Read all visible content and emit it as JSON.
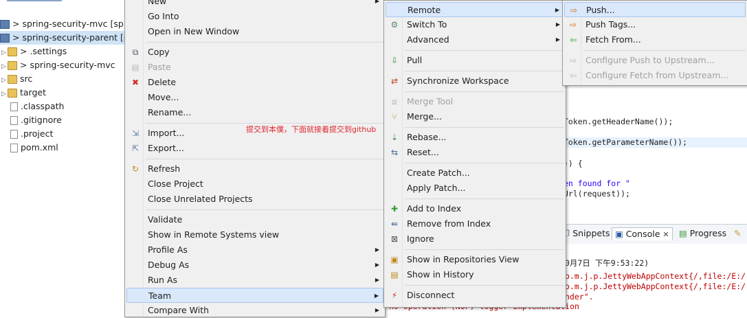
{
  "explorer": {
    "items": [
      {
        "label": "> spring-security-mvc  [sprin",
        "kind": "project"
      },
      {
        "label": "> spring-security-parent  [sp",
        "kind": "project"
      },
      {
        "label": "> .settings",
        "kind": "folder"
      },
      {
        "label": "> spring-security-mvc",
        "kind": "folder"
      },
      {
        "label": "src",
        "kind": "folder"
      },
      {
        "label": "target",
        "kind": "folder"
      },
      {
        "label": ".classpath",
        "kind": "file"
      },
      {
        "label": ".gitignore",
        "kind": "file"
      },
      {
        "label": ".project",
        "kind": "file"
      },
      {
        "label": "pom.xml",
        "kind": "file"
      }
    ]
  },
  "annotation": "提交到本僕，下面就接着提交到github",
  "main_menu": {
    "items": [
      {
        "label": "New",
        "icon": "none",
        "submenu": true,
        "disabled": false
      },
      {
        "label": "Go Into",
        "icon": "none",
        "submenu": false,
        "disabled": false
      },
      {
        "label": "Open in New Window",
        "icon": "none",
        "submenu": false,
        "disabled": false
      },
      {
        "label": "Copy",
        "icon": "copy-icon",
        "submenu": false,
        "disabled": false
      },
      {
        "label": "Paste",
        "icon": "paste-icon",
        "submenu": false,
        "disabled": true
      },
      {
        "label": "Delete",
        "icon": "delete-icon",
        "submenu": false,
        "disabled": false
      },
      {
        "label": "Move...",
        "icon": "none",
        "submenu": false,
        "disabled": false
      },
      {
        "label": "Rename...",
        "icon": "none",
        "submenu": false,
        "disabled": false
      },
      {
        "label": "Import...",
        "icon": "import-icon",
        "submenu": false,
        "disabled": false
      },
      {
        "label": "Export...",
        "icon": "export-icon",
        "submenu": false,
        "disabled": false
      },
      {
        "label": "Refresh",
        "icon": "refresh-icon",
        "submenu": false,
        "disabled": false
      },
      {
        "label": "Close Project",
        "icon": "none",
        "submenu": false,
        "disabled": false
      },
      {
        "label": "Close Unrelated Projects",
        "icon": "none",
        "submenu": false,
        "disabled": false
      },
      {
        "label": "Validate",
        "icon": "none",
        "submenu": false,
        "disabled": false
      },
      {
        "label": "Show in Remote Systems view",
        "icon": "none",
        "submenu": false,
        "disabled": false
      },
      {
        "label": "Profile As",
        "icon": "none",
        "submenu": true,
        "disabled": false
      },
      {
        "label": "Debug As",
        "icon": "none",
        "submenu": true,
        "disabled": false
      },
      {
        "label": "Run As",
        "icon": "none",
        "submenu": true,
        "disabled": false
      },
      {
        "label": "Team",
        "icon": "none",
        "submenu": true,
        "disabled": false,
        "highlighted": true
      },
      {
        "label": "Compare With",
        "icon": "none",
        "submenu": true,
        "disabled": false
      }
    ]
  },
  "team_menu": {
    "items": [
      {
        "label": "Remote",
        "icon": "none",
        "submenu": true,
        "highlighted": true
      },
      {
        "label": "Switch To",
        "icon": "switch-icon",
        "submenu": true
      },
      {
        "label": "Advanced",
        "icon": "none",
        "submenu": true
      },
      {
        "label": "Pull",
        "icon": "pull-icon",
        "submenu": false
      },
      {
        "label": "Synchronize Workspace",
        "icon": "synchronize-icon",
        "submenu": false
      },
      {
        "label": "Merge Tool",
        "icon": "merge-tool-icon",
        "submenu": false,
        "disabled": true
      },
      {
        "label": "Merge...",
        "icon": "merge-icon",
        "submenu": false
      },
      {
        "label": "Rebase...",
        "icon": "rebase-icon",
        "submenu": false
      },
      {
        "label": "Reset...",
        "icon": "reset-icon",
        "submenu": false
      },
      {
        "label": "Create Patch...",
        "icon": "none",
        "submenu": false
      },
      {
        "label": "Apply Patch...",
        "icon": "none",
        "submenu": false
      },
      {
        "label": "Add to Index",
        "icon": "add-icon",
        "submenu": false
      },
      {
        "label": "Remove from Index",
        "icon": "remove-index-icon",
        "submenu": false
      },
      {
        "label": "Ignore",
        "icon": "ignore-icon",
        "submenu": false
      },
      {
        "label": "Show in Repositories View",
        "icon": "repositories-icon",
        "submenu": false
      },
      {
        "label": "Show in History",
        "icon": "history-icon",
        "submenu": false
      },
      {
        "label": "Disconnect",
        "icon": "disconnect-icon",
        "submenu": false
      }
    ]
  },
  "remote_menu": {
    "items": [
      {
        "label": "Push...",
        "icon": "push-icon",
        "highlighted": true
      },
      {
        "label": "Push Tags...",
        "icon": "push-tags-icon"
      },
      {
        "label": "Fetch From...",
        "icon": "fetch-icon"
      },
      {
        "label": "Configure Push to Upstream...",
        "icon": "configure-push-icon",
        "disabled": true
      },
      {
        "label": "Configure Fetch from Upstream...",
        "icon": "configure-fetch-icon",
        "disabled": true
      }
    ]
  },
  "editor": {
    "lines": [
      "Token.getHeaderName());",
      "Token.getParameterName());",
      ")) {",
      "en found for \"",
      "Url(request));"
    ]
  },
  "views": {
    "snippets": "Snippets",
    "console": "Console",
    "progress": "Progress"
  },
  "console": {
    "lines": [
      "0月7日 下午9:53:22)",
      "o.m.j.p.JettyWebAppContext{/,file:/E:/",
      "o.m.j.p.JettyWebAppContext{/,file:/E:/",
      "nder\".",
      "no-operation (NOP) logger implementation"
    ]
  }
}
